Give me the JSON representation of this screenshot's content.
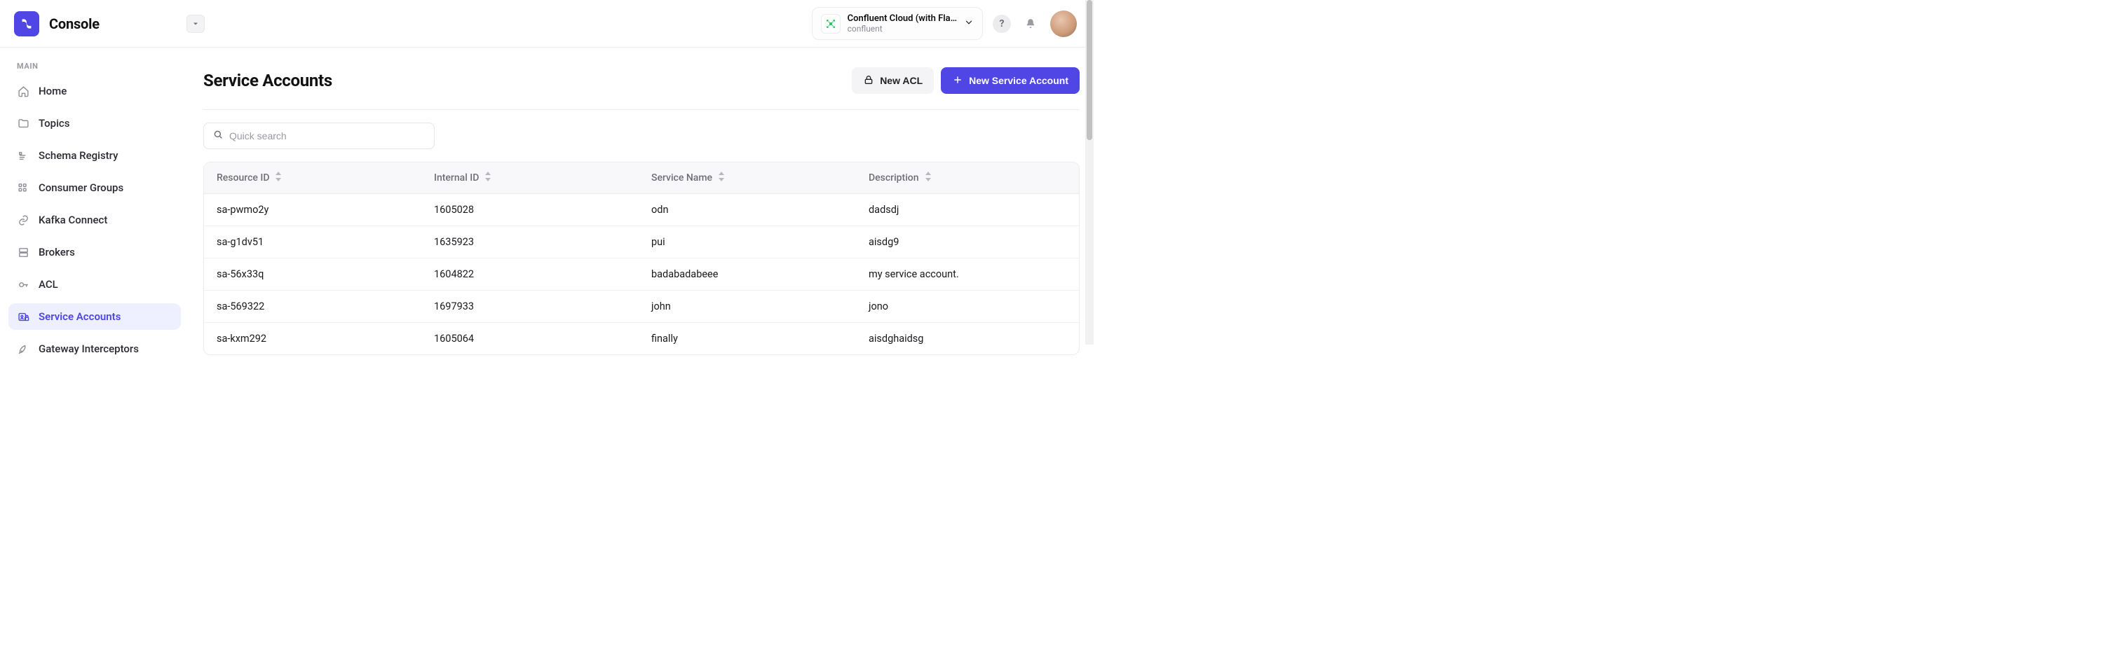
{
  "header": {
    "app_name": "Console",
    "cluster": {
      "title": "Confluent Cloud (with Fla…",
      "subtitle": "confluent"
    }
  },
  "sidebar": {
    "heading": "MAIN",
    "items": [
      {
        "label": "Home",
        "name": "home"
      },
      {
        "label": "Topics",
        "name": "topics"
      },
      {
        "label": "Schema Registry",
        "name": "schema-registry"
      },
      {
        "label": "Consumer Groups",
        "name": "consumer-groups"
      },
      {
        "label": "Kafka Connect",
        "name": "kafka-connect"
      },
      {
        "label": "Brokers",
        "name": "brokers"
      },
      {
        "label": "ACL",
        "name": "acl"
      },
      {
        "label": "Service Accounts",
        "name": "service-accounts"
      },
      {
        "label": "Gateway Interceptors",
        "name": "gateway-interceptors"
      }
    ]
  },
  "page": {
    "title": "Service Accounts",
    "actions": {
      "new_acl": "New ACL",
      "new_service_account": "New Service Account"
    },
    "search_placeholder": "Quick search"
  },
  "table": {
    "columns": [
      "Resource ID",
      "Internal ID",
      "Service Name",
      "Description"
    ],
    "rows": [
      {
        "resource_id": "sa-pwmo2y",
        "internal_id": "1605028",
        "service_name": "odn",
        "description": "dadsdj"
      },
      {
        "resource_id": "sa-g1dv51",
        "internal_id": "1635923",
        "service_name": "pui",
        "description": "aisdg9"
      },
      {
        "resource_id": "sa-56x33q",
        "internal_id": "1604822",
        "service_name": "badabadabeee",
        "description": "my service account."
      },
      {
        "resource_id": "sa-569322",
        "internal_id": "1697933",
        "service_name": "john",
        "description": "jono"
      },
      {
        "resource_id": "sa-kxm292",
        "internal_id": "1605064",
        "service_name": "finally",
        "description": "aisdghaidsg"
      }
    ]
  }
}
